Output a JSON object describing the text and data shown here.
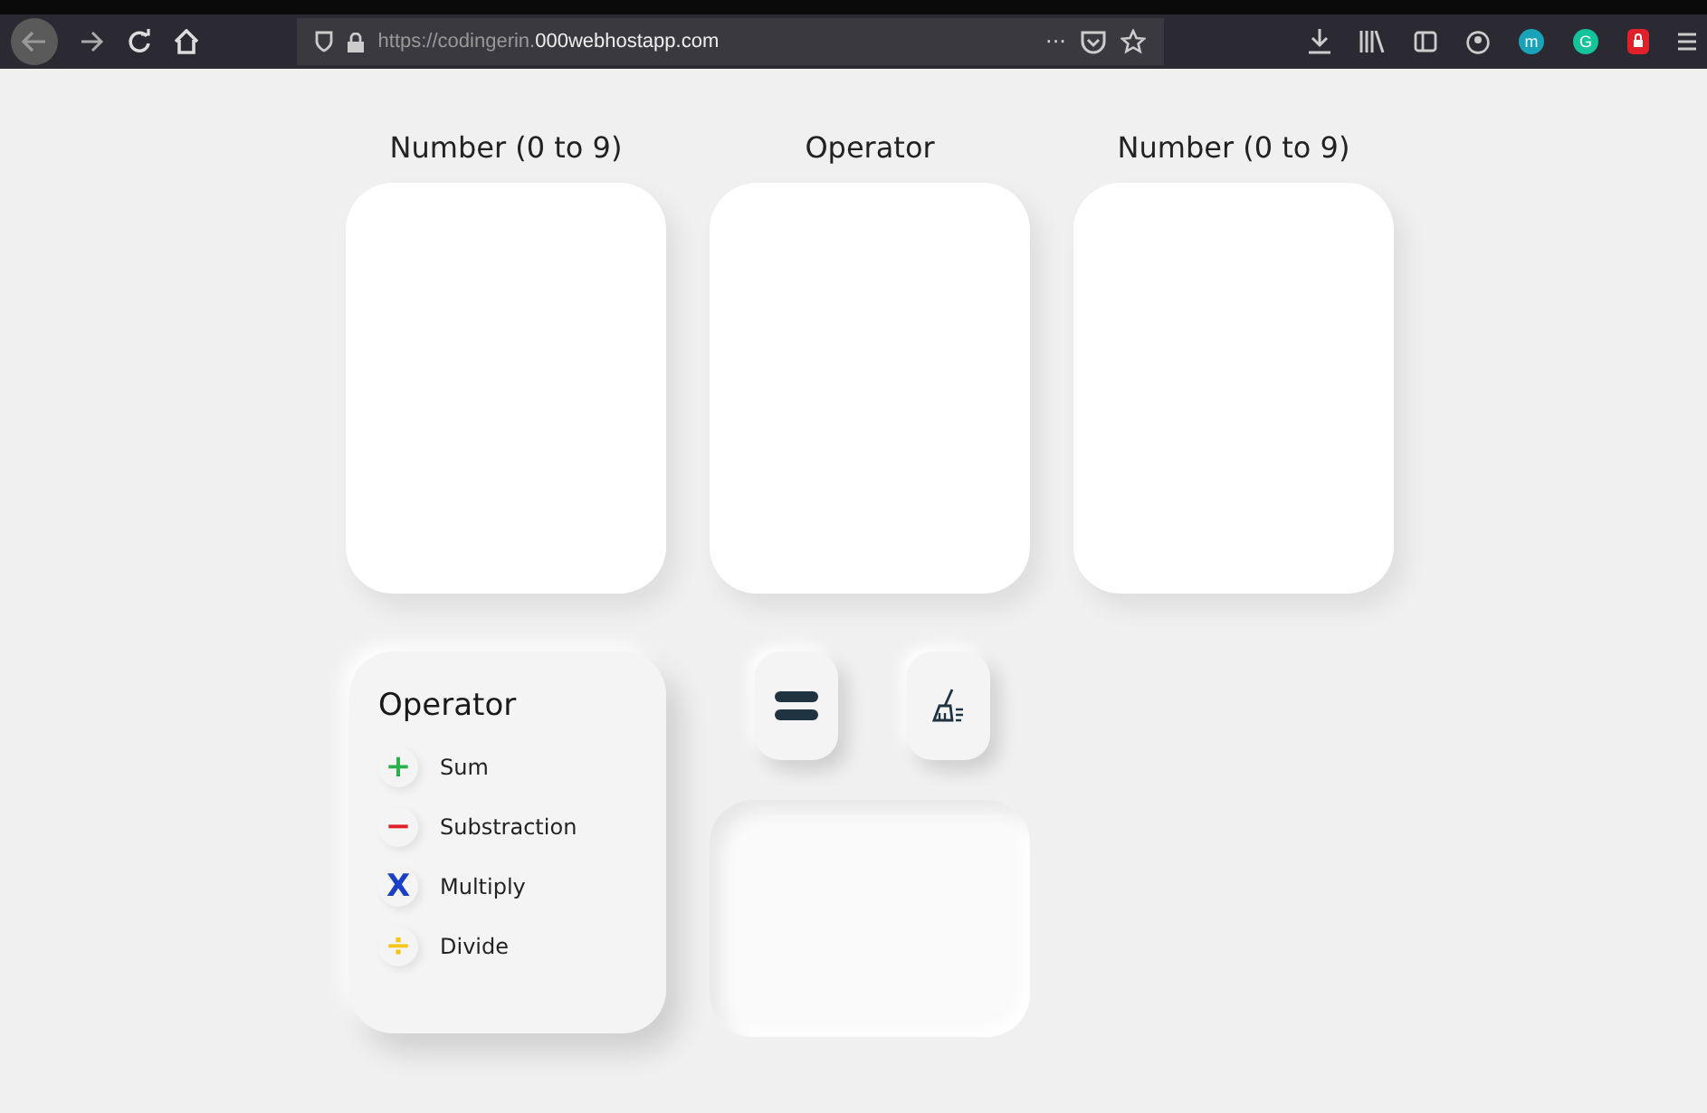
{
  "browser": {
    "url_host": "https://codingerin.",
    "url_domain": "000webhostapp.com",
    "menu_dots": "···",
    "extensions": [
      {
        "letter": "m",
        "color": "#1aa3b8"
      },
      {
        "letter": "G",
        "color": "#15c39a"
      }
    ]
  },
  "inputs": [
    {
      "label": "Number (0 to 9)"
    },
    {
      "label": "Operator"
    },
    {
      "label": "Number (0 to 9)"
    }
  ],
  "operator_panel": {
    "title": "Operator",
    "operators": [
      {
        "symbol": "+",
        "label": "Sum",
        "color": "#2bb24c"
      },
      {
        "symbol": "−",
        "label": "Substraction",
        "color": "#e0202a"
      },
      {
        "symbol": "X",
        "label": "Multiply",
        "color": "#1a3fc9"
      },
      {
        "symbol": "÷",
        "label": "Divide",
        "color": "#f5c518"
      }
    ]
  },
  "actions": [
    {
      "kind": "equals"
    },
    {
      "kind": "clear"
    }
  ]
}
